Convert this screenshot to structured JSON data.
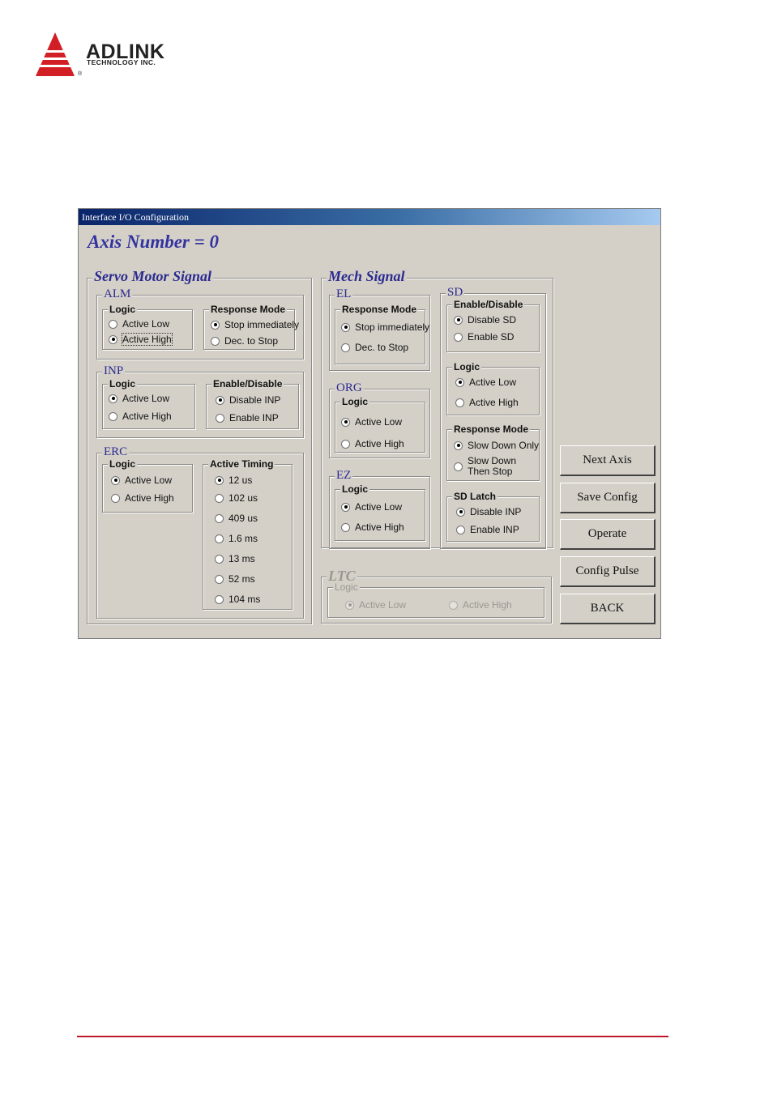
{
  "logo": {
    "name": "ADLINK",
    "subtitle": "TECHNOLOGY INC.",
    "registered": "®",
    "color": "#d21f26"
  },
  "window": {
    "title": "Interface I/O Configuration",
    "axis_label": "Axis Number =  0"
  },
  "servo": {
    "title": "Servo Motor Signal",
    "alm": {
      "title": "ALM",
      "logic": {
        "title": "Logic",
        "options": [
          "Active Low",
          "Active High"
        ],
        "selected": 1
      },
      "response": {
        "title": "Response Mode",
        "options": [
          "Stop immediately",
          "Dec. to Stop"
        ],
        "selected": 0
      }
    },
    "inp": {
      "title": "INP",
      "logic": {
        "title": "Logic",
        "options": [
          "Active Low",
          "Active High"
        ],
        "selected": 0
      },
      "enable": {
        "title": "Enable/Disable",
        "options": [
          "Disable INP",
          "Enable INP"
        ],
        "selected": 0
      }
    },
    "erc": {
      "title": "ERC",
      "logic": {
        "title": "Logic",
        "options": [
          "Active Low",
          "Active High"
        ],
        "selected": 0
      },
      "timing": {
        "title": "Active Timing",
        "options": [
          "12 us",
          "102 us",
          "409 us",
          "1.6 ms",
          "13 ms",
          "52 ms",
          "104 ms"
        ],
        "selected": 0
      }
    }
  },
  "mech": {
    "title": "Mech Signal",
    "el": {
      "title": "EL",
      "response": {
        "title": "Response Mode",
        "options": [
          "Stop immediately",
          "Dec. to Stop"
        ],
        "selected": 0
      }
    },
    "org": {
      "title": "ORG",
      "logic": {
        "title": "Logic",
        "options": [
          "Active Low",
          "Active High"
        ],
        "selected": 0
      }
    },
    "ez": {
      "title": "EZ",
      "logic": {
        "title": "Logic",
        "options": [
          "Active Low",
          "Active High"
        ],
        "selected": 0
      }
    },
    "sd": {
      "title": "SD",
      "enable": {
        "title": "Enable/Disable",
        "options": [
          "Disable SD",
          "Enable SD"
        ],
        "selected": 0
      },
      "logic": {
        "title": "Logic",
        "options": [
          "Active Low",
          "Active High"
        ],
        "selected": 0
      },
      "response": {
        "title": "Response Mode",
        "options": [
          "Slow Down Only",
          "Slow Down Then Stop"
        ],
        "selected": 0
      },
      "latch": {
        "title": "SD Latch",
        "options": [
          "Disable INP",
          "Enable INP"
        ],
        "selected": 0
      }
    }
  },
  "ltc": {
    "title": "LTC",
    "logic": {
      "title": "Logic",
      "options": [
        "Active Low",
        "Active High"
      ],
      "selected": 0
    }
  },
  "buttons": {
    "next_axis": "Next Axis",
    "save_config": "Save Config",
    "operate": "Operate",
    "config_pulse": "Config Pulse",
    "back": "BACK"
  }
}
